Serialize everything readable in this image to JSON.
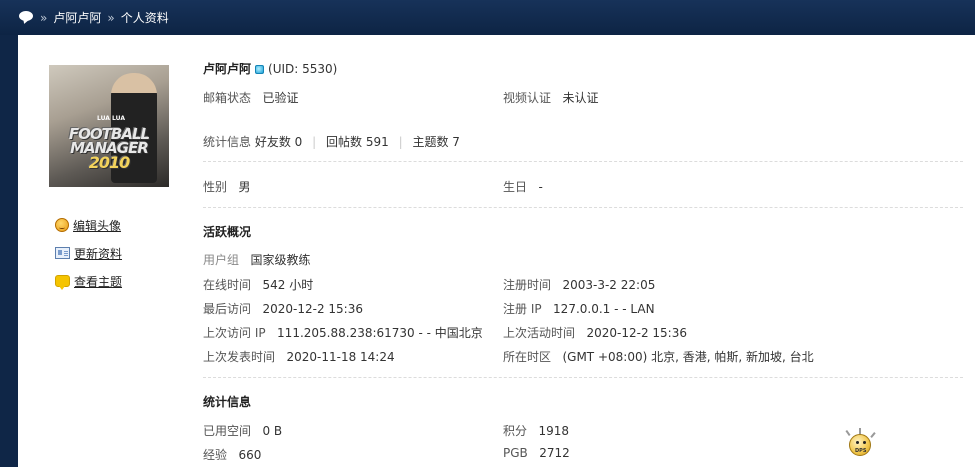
{
  "breadcrumb": {
    "home_icon": "forum-bubble-icon",
    "separator": "»",
    "items": [
      "卢阿卢阿",
      "个人资料"
    ]
  },
  "avatar": {
    "line_small": "LUA LUA",
    "line1": "FOOTBALL",
    "line2": "MANAGER",
    "line3": "2010"
  },
  "side_links": [
    {
      "icon": "smiley-face-icon",
      "label": "编辑头像"
    },
    {
      "icon": "profile-card-icon",
      "label": "更新资料"
    },
    {
      "icon": "speech-bubble-icon",
      "label": "查看主题"
    }
  ],
  "profile": {
    "username": "卢阿卢阿",
    "uid": "(UID: 5530)",
    "email_status": {
      "label": "邮箱状态",
      "value": "已验证"
    },
    "video_verify": {
      "label": "视频认证",
      "value": "未认证"
    },
    "stats": {
      "label": "统计信息",
      "friends": "好友数 0",
      "replies": "回帖数 591",
      "topics": "主题数 7",
      "divider": "|"
    },
    "gender": {
      "label": "性别",
      "value": "男"
    },
    "birthday": {
      "label": "生日",
      "value": "-"
    }
  },
  "activity": {
    "title": "活跃概况",
    "user_group": {
      "label": "用户组",
      "value": "国家级教练"
    },
    "online_time": {
      "label": "在线时间",
      "value": "542 小时"
    },
    "register_time": {
      "label": "注册时间",
      "value": "2003-3-2 22:05"
    },
    "last_visit": {
      "label": "最后访问",
      "value": "2020-12-2 15:36"
    },
    "register_ip": {
      "label": "注册 IP",
      "value": "127.0.0.1 - - LAN"
    },
    "last_visit_ip": {
      "label": "上次访问 IP",
      "value": "111.205.88.238:61730 - - 中国北京"
    },
    "last_active": {
      "label": "上次活动时间",
      "value": "2020-12-2 15:36"
    },
    "last_post": {
      "label": "上次发表时间",
      "value": "2020-11-18 14:24"
    },
    "timezone": {
      "label": "所在时区",
      "value": "(GMT +08:00) 北京, 香港, 帕斯, 新加坡, 台北"
    }
  },
  "statistics": {
    "title": "统计信息",
    "space_used": {
      "label": "已用空间",
      "value": "0 B"
    },
    "points": {
      "label": "积分",
      "value": "1918"
    },
    "experience": {
      "label": "经验",
      "value": "660"
    },
    "pgb": {
      "label": "PGB",
      "value": "2712"
    }
  },
  "mascot": {
    "icon": "sun-mascot-icon",
    "text": "DPS"
  }
}
